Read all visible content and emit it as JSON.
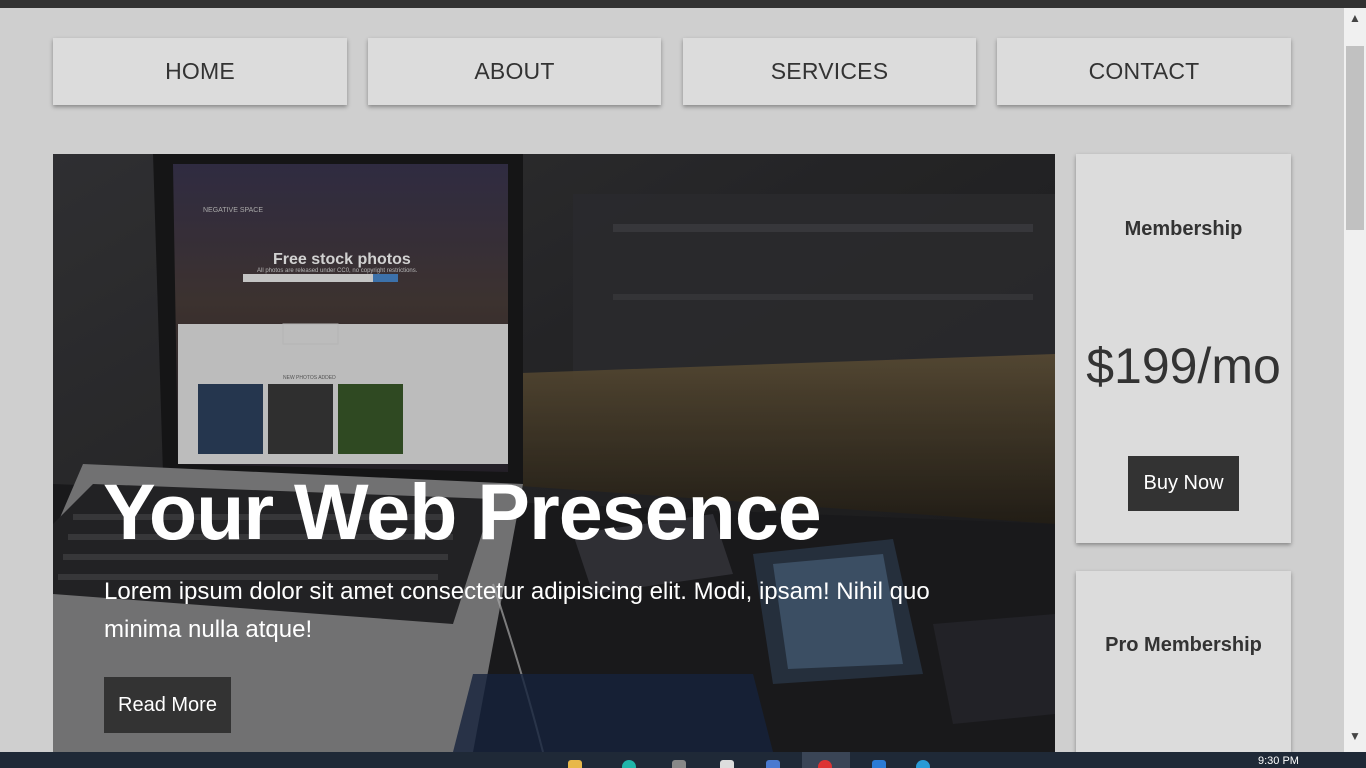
{
  "nav": {
    "items": [
      {
        "label": "HOME"
      },
      {
        "label": "ABOUT"
      },
      {
        "label": "SERVICES"
      },
      {
        "label": "CONTACT"
      }
    ]
  },
  "hero": {
    "image_text": {
      "site_name": "NEGATIVE SPACE",
      "headline": "Free stock photos",
      "subline": "All photos are released under CC0, no copyright restrictions.",
      "section": "NEW PHOTOS ADDED"
    },
    "title": "Your Web Presence",
    "text": "Lorem ipsum dolor sit amet consectetur adipisicing elit. Modi, ipsam! Nihil quo minima nulla atque!",
    "button_label": "Read More"
  },
  "sidebar": {
    "cards": [
      {
        "title": "Membership",
        "price": "$199/mo",
        "button_label": "Buy Now"
      },
      {
        "title": "Pro Membership"
      }
    ]
  },
  "taskbar": {
    "time": "9:30 PM"
  },
  "colors": {
    "page_bg": "#cfcfcf",
    "nav_bg": "#dcdcdc",
    "button_bg": "#333333",
    "text_dark": "#333333"
  },
  "icons": {
    "scroll_up": "chevron-up-icon",
    "scroll_down": "chevron-down-icon"
  }
}
